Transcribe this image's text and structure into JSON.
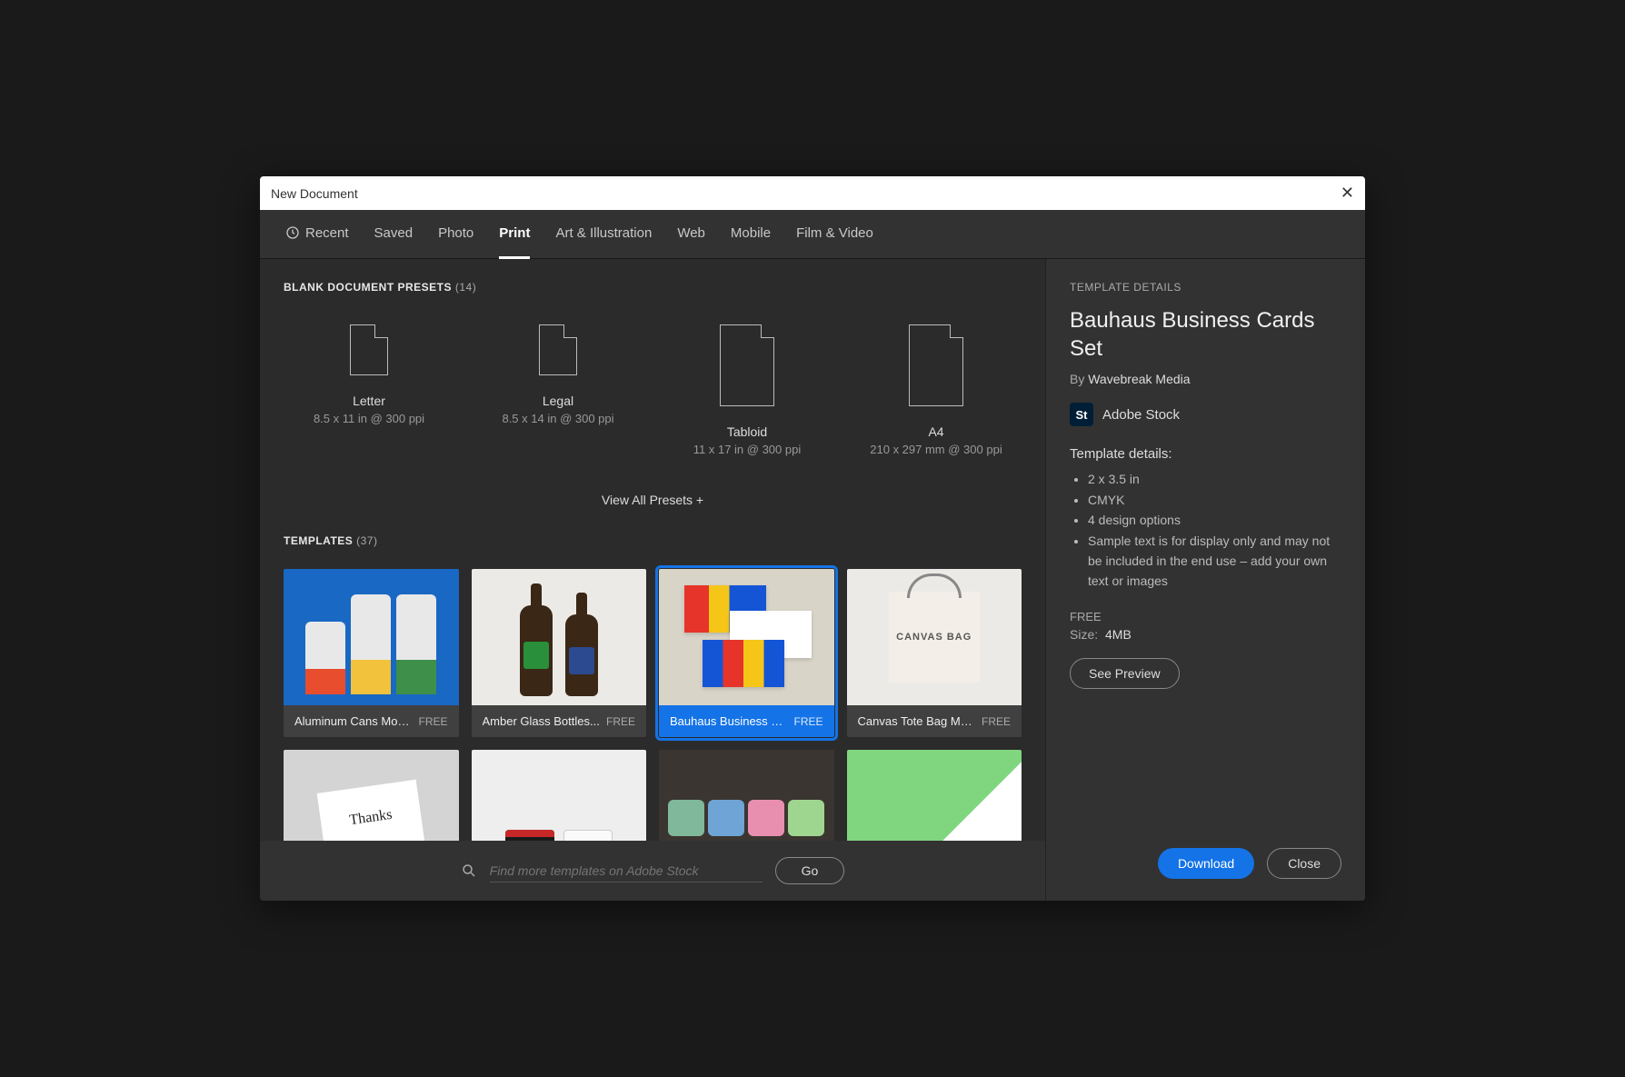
{
  "dialog": {
    "title": "New Document"
  },
  "tabs": {
    "recent": "Recent",
    "saved": "Saved",
    "photo": "Photo",
    "print": "Print",
    "art": "Art & Illustration",
    "web": "Web",
    "mobile": "Mobile",
    "film": "Film & Video"
  },
  "presets": {
    "header": "BLANK DOCUMENT PRESETS",
    "count": "(14)",
    "items": [
      {
        "name": "Letter",
        "dims": "8.5 x 11 in @ 300 ppi"
      },
      {
        "name": "Legal",
        "dims": "8.5 x 14 in @ 300 ppi"
      },
      {
        "name": "Tabloid",
        "dims": "11 x 17 in @ 300 ppi"
      },
      {
        "name": "A4",
        "dims": "210 x 297 mm @ 300 ppi"
      }
    ],
    "view_all": "View All Presets +"
  },
  "templates": {
    "header": "TEMPLATES",
    "count": "(37)",
    "badge": "FREE",
    "items": [
      {
        "title": "Aluminum Cans Moc..."
      },
      {
        "title": "Amber Glass Bottles..."
      },
      {
        "title": "Bauhaus Business Ca..."
      },
      {
        "title": "Canvas Tote Bag Mo..."
      }
    ]
  },
  "search": {
    "placeholder": "Find more templates on Adobe Stock",
    "go": "Go"
  },
  "details": {
    "label": "TEMPLATE DETAILS",
    "name": "Bauhaus Business Cards Set",
    "by": "By",
    "author": "Wavebreak Media",
    "stock_badge": "St",
    "stock_label": "Adobe Stock",
    "details_h": "Template details:",
    "bullets": [
      "2 x 3.5 in",
      "CMYK",
      "4 design options",
      "Sample text is for display only and may not be included in the end use – add your own text or images"
    ],
    "free": "FREE",
    "size_label": "Size:",
    "size_value": "4MB",
    "preview": "See Preview"
  },
  "footer": {
    "download": "Download",
    "close": "Close"
  }
}
